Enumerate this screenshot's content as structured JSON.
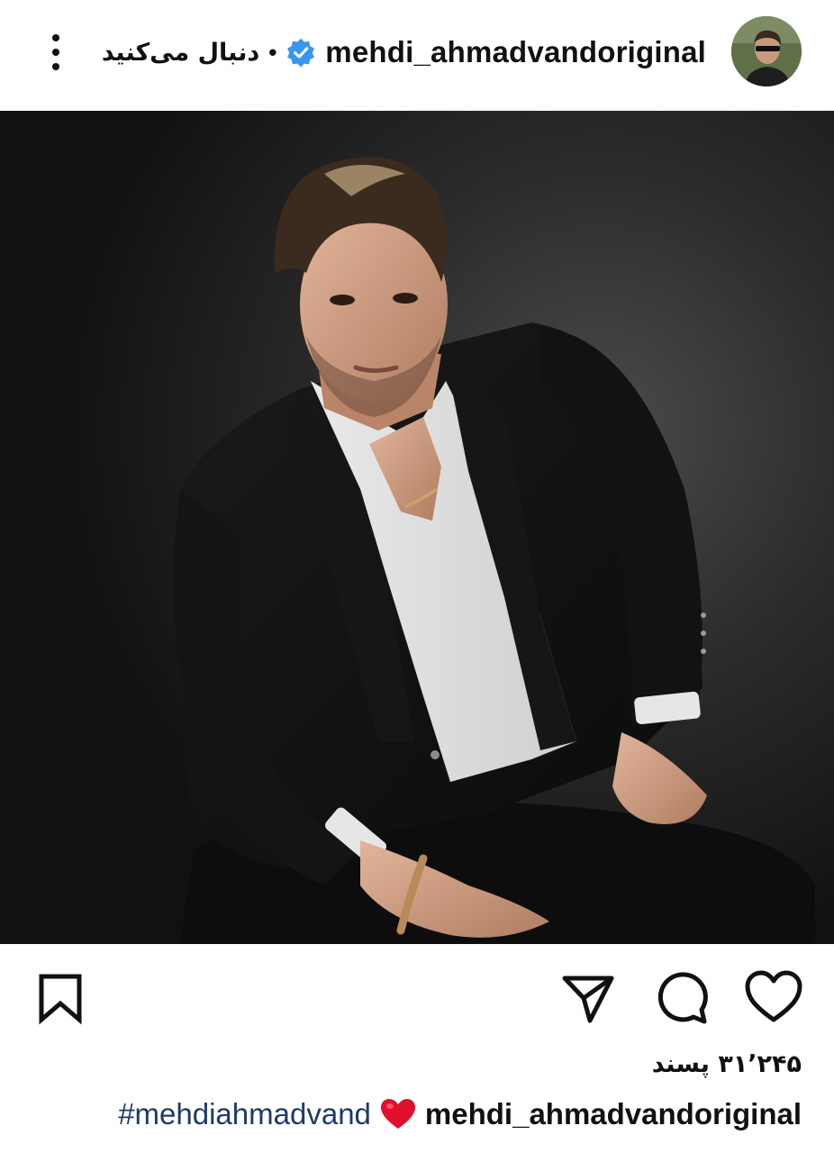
{
  "header": {
    "username": "mehdi_ahmadvandoriginal",
    "follow_status": "دنبال می‌کنید",
    "separator": "•"
  },
  "actions": {
    "like_icon": "heart-outline-icon",
    "comment_icon": "comment-bubble-icon",
    "share_icon": "paper-plane-icon",
    "save_icon": "bookmark-icon"
  },
  "likes": {
    "text": "۳۱٬۲۴۵ پسند"
  },
  "caption": {
    "username": "mehdi_ahmadvandoriginal",
    "hashtag": "#mehdiahmadvand"
  },
  "colors": {
    "verified_blue": "#3897f0",
    "hashtag_blue": "#1f3a68",
    "heart_red": "#e0102c"
  }
}
